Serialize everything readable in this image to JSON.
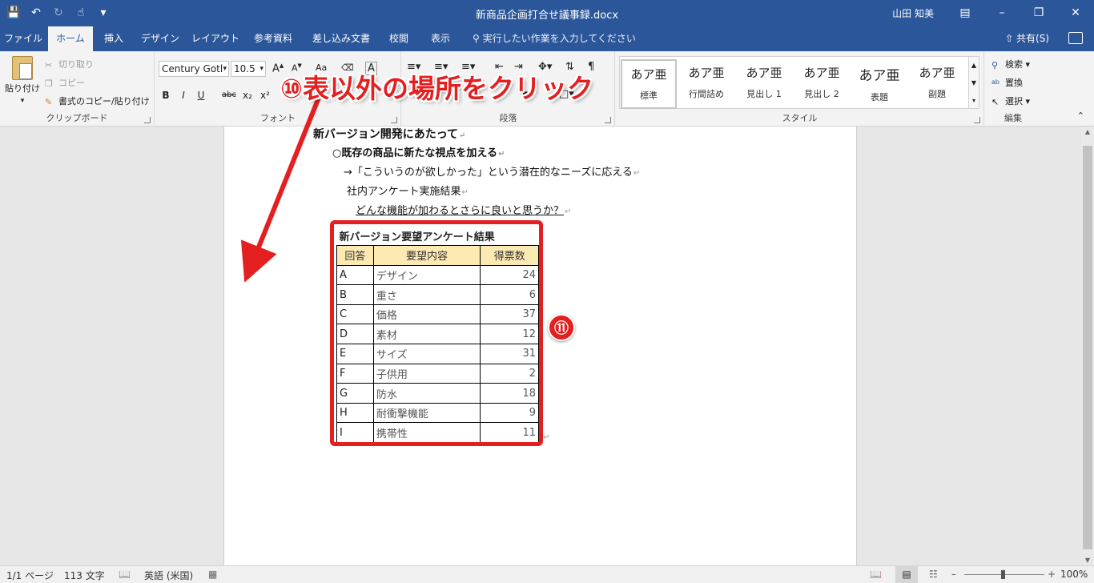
{
  "titlebar": {
    "document_title": "新商品企画打合せ議事録.docx",
    "user_name": "山田 知美"
  },
  "tabs": [
    "ファイル",
    "ホーム",
    "挿入",
    "デザイン",
    "レイアウト",
    "参考資料",
    "差し込み文書",
    "校閲",
    "表示"
  ],
  "tell_me": "実行したい作業を入力してください",
  "share_label": "共有(S)",
  "ribbon": {
    "clipboard": {
      "paste": "貼り付け",
      "cut": "切り取り",
      "copy": "コピー",
      "format_painter": "書式のコピー/貼り付け",
      "label": "クリップボード"
    },
    "font": {
      "font_name": "Century Gotl",
      "font_size": "10.5",
      "label": "フォント",
      "bold": "B",
      "italic": "I",
      "underline": "U",
      "strike": "abc",
      "sub": "x₂",
      "sup": "x²"
    },
    "paragraph": {
      "label": "段落"
    },
    "styles": {
      "label": "スタイル",
      "items": [
        {
          "sample": "あア亜",
          "name": "標準"
        },
        {
          "sample": "あア亜",
          "name": "行間詰め"
        },
        {
          "sample": "あア亜",
          "name": "見出し 1"
        },
        {
          "sample": "あア亜",
          "name": "見出し 2"
        },
        {
          "sample": "あア亜",
          "name": "表題"
        },
        {
          "sample": "あア亜",
          "name": "副題"
        }
      ]
    },
    "editing": {
      "find": "検索",
      "replace": "置換",
      "select": "選択",
      "label": "編集"
    }
  },
  "document": {
    "heading": "新バージョン開発にあたって",
    "bullet": "○既存の商品に新たな視点を加える",
    "line1": "→「こういうのが欲しかった」という潜在的なニーズに応える",
    "line2": "社内アンケート実施結果",
    "line3": "どんな機能が加わるとさらに良いと思うか？",
    "table": {
      "caption": "新バージョン要望アンケート結果",
      "headers": [
        "回答",
        "要望内容",
        "得票数"
      ],
      "rows": [
        [
          "A",
          "デザイン",
          "24"
        ],
        [
          "B",
          "重さ",
          "6"
        ],
        [
          "C",
          "価格",
          "37"
        ],
        [
          "D",
          "素材",
          "12"
        ],
        [
          "E",
          "サイズ",
          "31"
        ],
        [
          "F",
          "子供用",
          "2"
        ],
        [
          "G",
          "防水",
          "18"
        ],
        [
          "H",
          "耐衝撃機能",
          "9"
        ],
        [
          "I",
          "携帯性",
          "11"
        ]
      ]
    }
  },
  "statusbar": {
    "page": "1/1 ページ",
    "words": "113 文字",
    "language": "英語 (米国)",
    "zoom": "100%"
  },
  "annotations": {
    "step10": "⑩表以外の場所をクリック",
    "step11": "⑪",
    "color": "#e41f1f"
  }
}
